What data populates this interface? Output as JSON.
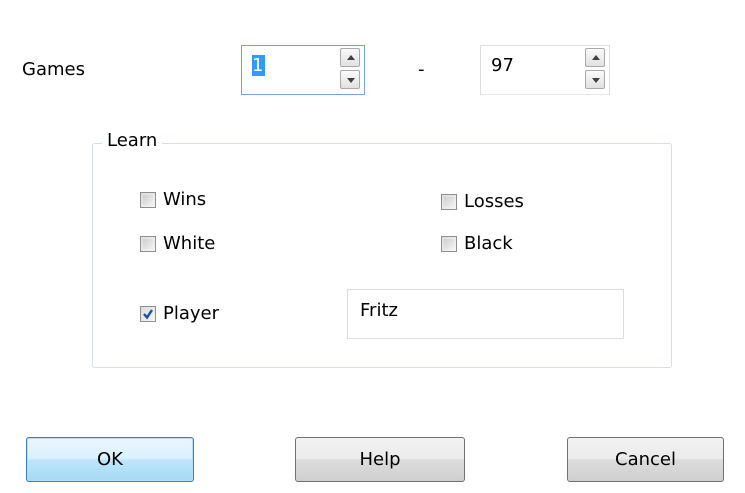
{
  "games": {
    "label": "Games",
    "from_value": "1",
    "separator": "-",
    "to_value": "97"
  },
  "learn": {
    "title": "Learn",
    "options": {
      "wins": {
        "label": "Wins",
        "checked": false
      },
      "losses": {
        "label": "Losses",
        "checked": false
      },
      "white": {
        "label": "White",
        "checked": false
      },
      "black": {
        "label": "Black",
        "checked": false
      },
      "player": {
        "label": "Player",
        "checked": true
      }
    },
    "player_name": "Fritz"
  },
  "buttons": {
    "ok": "OK",
    "help": "Help",
    "cancel": "Cancel"
  },
  "colors": {
    "selection": "#3399ff",
    "default_button": "#bee6fd",
    "check_mark": "#1c4fa0"
  }
}
